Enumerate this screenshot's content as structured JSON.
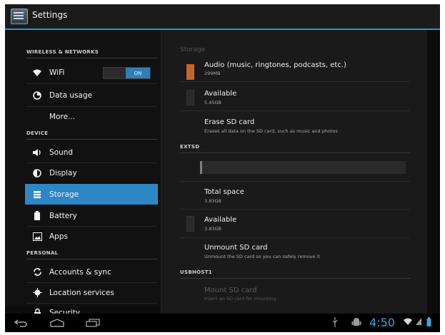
{
  "app": {
    "title": "Settings"
  },
  "sidebar": {
    "sections": [
      {
        "label": "WIRELESS & NETWORKS"
      },
      {
        "label": "DEVICE"
      },
      {
        "label": "PERSONAL"
      }
    ],
    "items": [
      {
        "label": "WiFi",
        "icon": "wifi-icon"
      },
      {
        "label": "Data usage",
        "icon": "data-usage-icon"
      },
      {
        "label": "More..."
      },
      {
        "label": "Sound",
        "icon": "speaker-icon"
      },
      {
        "label": "Display",
        "icon": "display-icon"
      },
      {
        "label": "Storage",
        "icon": "storage-icon"
      },
      {
        "label": "Battery",
        "icon": "battery-icon"
      },
      {
        "label": "Apps",
        "icon": "apps-icon"
      },
      {
        "label": "Accounts & sync",
        "icon": "sync-icon"
      },
      {
        "label": "Location services",
        "icon": "location-icon"
      },
      {
        "label": "Security",
        "icon": "lock-icon"
      }
    ],
    "wifi_toggle": {
      "state_label": "ON"
    }
  },
  "detail": {
    "title": "Storage",
    "audio": {
      "title": "Audio (music, ringtones, podcasts, etc.)",
      "value": "299MB"
    },
    "available_internal": {
      "title": "Available",
      "value": "5.45GB"
    },
    "erase": {
      "title": "Erase SD card",
      "subtitle": "Erases all data on the SD card, such as music and photos"
    },
    "extsd_header": "EXTSD",
    "extsd_usage_fraction": 0.01,
    "total_space": {
      "title": "Total space",
      "value": "3.83GB"
    },
    "available_extsd": {
      "title": "Available",
      "value": "3.83GB"
    },
    "unmount": {
      "title": "Unmount SD card",
      "subtitle": "Unmount the SD card so you can safely remove it"
    },
    "usbhost_header": "USBHOST1",
    "mount": {
      "title": "Mount SD card",
      "subtitle": "Insert an SD card for mounting"
    }
  },
  "statusbar": {
    "time": "4:50"
  },
  "colors": {
    "accent": "#2d87c5",
    "clock": "#3ea3d9",
    "audio_swatch": "#c8642a"
  }
}
